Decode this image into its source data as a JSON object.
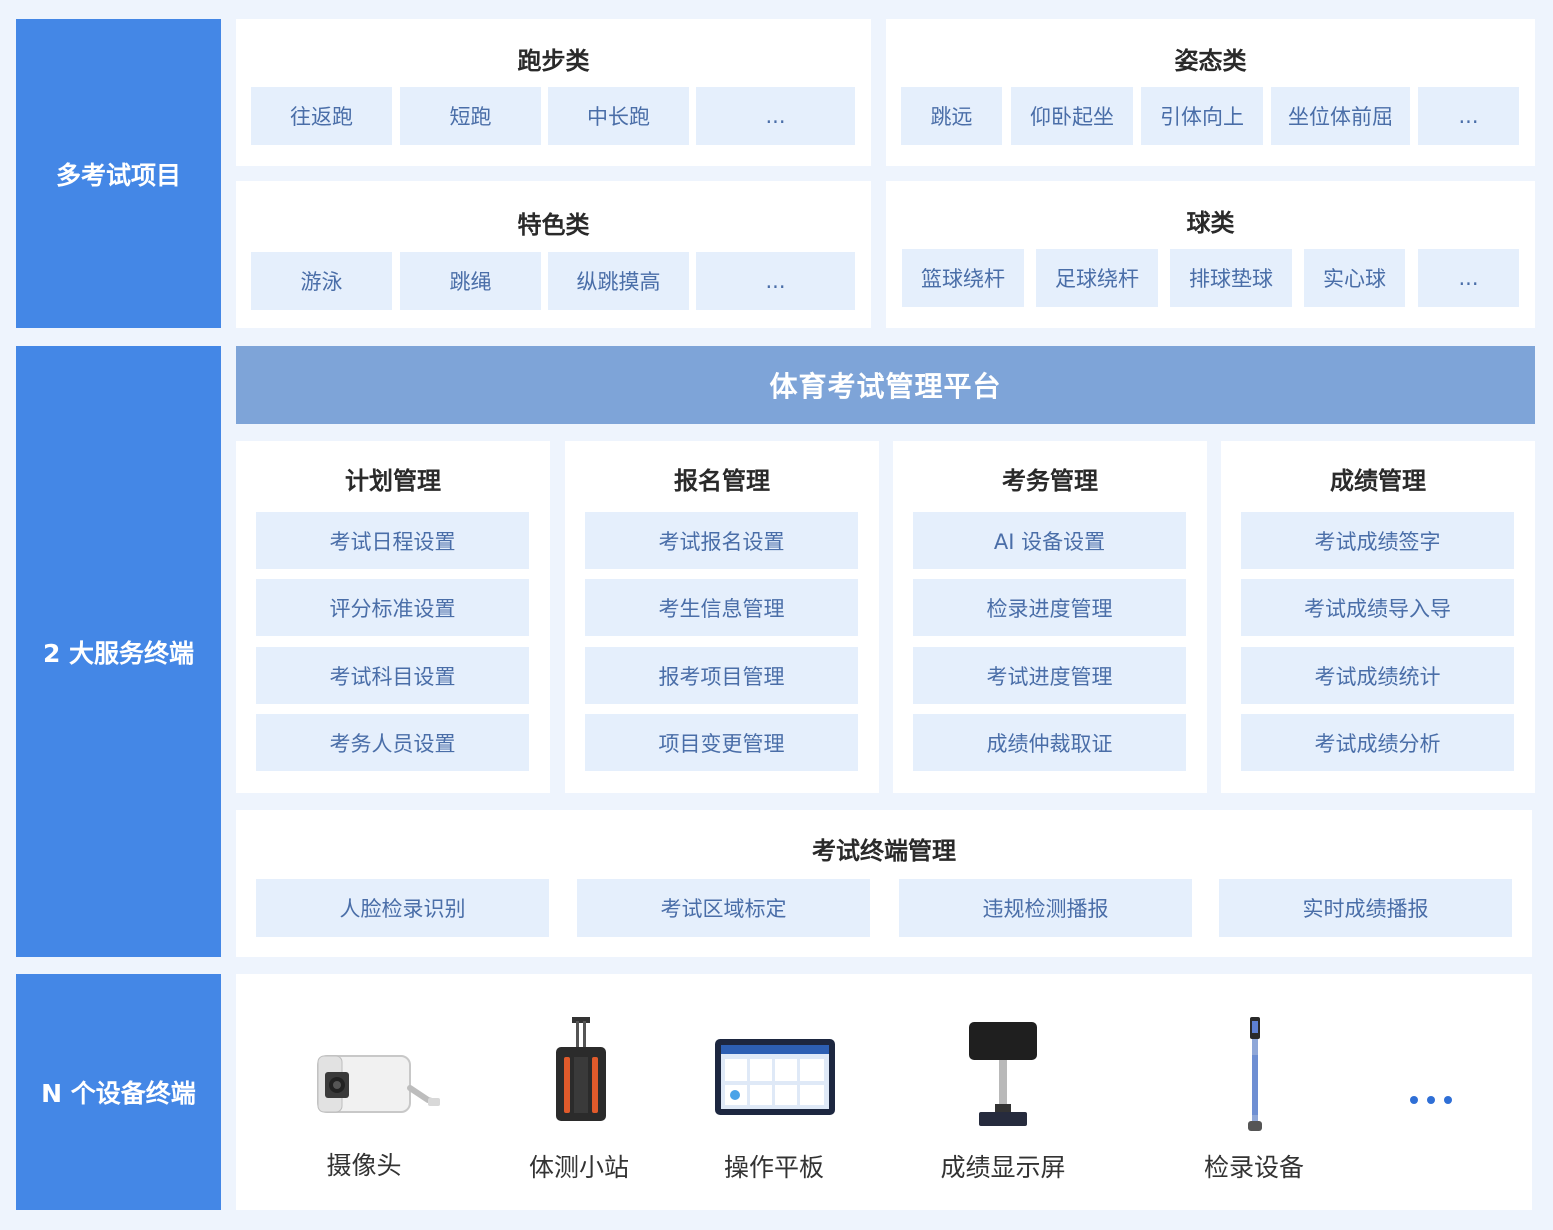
{
  "side_labels": {
    "exam_items": "多考试项目",
    "services": "2 大服务终端",
    "devices": "N 个设备终端"
  },
  "categories": {
    "running": {
      "title": "跑步类",
      "items": [
        "往返跑",
        "短跑",
        "中长跑",
        "..."
      ]
    },
    "posture": {
      "title": "姿态类",
      "items": [
        "跳远",
        "仰卧起坐",
        "引体向上",
        "坐位体前屈",
        "..."
      ]
    },
    "special": {
      "title": "特色类",
      "items": [
        "游泳",
        "跳绳",
        "纵跳摸高",
        "..."
      ]
    },
    "ball": {
      "title": "球类",
      "items": [
        "篮球绕杆",
        "足球绕杆",
        "排球垫球",
        "实心球",
        "..."
      ]
    }
  },
  "platform": {
    "title": "体育考试管理平台"
  },
  "modules": [
    {
      "title": "计划管理",
      "items": [
        "考试日程设置",
        "评分标准设置",
        "考试科目设置",
        "考务人员设置"
      ]
    },
    {
      "title": "报名管理",
      "items": [
        "考试报名设置",
        "考生信息管理",
        "报考项目管理",
        "项目变更管理"
      ]
    },
    {
      "title": "考务管理",
      "items": [
        "AI 设备设置",
        "检录进度管理",
        "考试进度管理",
        "成绩仲裁取证"
      ]
    },
    {
      "title": "成绩管理",
      "items": [
        "考试成绩签字",
        "考试成绩导入导",
        "考试成绩统计",
        "考试成绩分析"
      ]
    }
  ],
  "terminal": {
    "title": "考试终端管理",
    "items": [
      "人脸检录识别",
      "考试区域标定",
      "违规检测播报",
      "实时成绩播报"
    ]
  },
  "devices": {
    "items": [
      "摄像头",
      "体测小站",
      "操作平板",
      "成绩显示屏",
      "检录设备"
    ],
    "icons": [
      "camera-icon",
      "station-icon",
      "tablet-icon",
      "display-screen-icon",
      "check-in-device-icon",
      "ellipsis-icon"
    ]
  },
  "colors": {
    "side": "#4487e6",
    "banner": "#7ea4d8",
    "chip_bg": "#e5effc",
    "chip_text": "#4a6ea8",
    "page_bg": "#eef4fd"
  }
}
